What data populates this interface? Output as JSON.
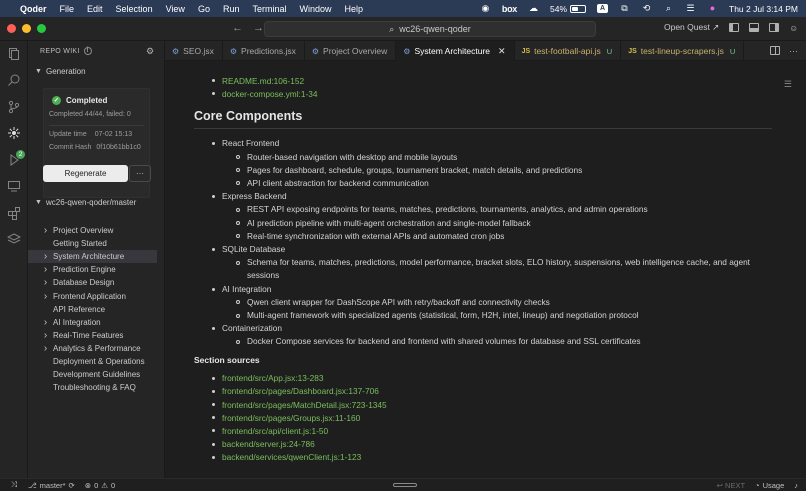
{
  "menubar": {
    "app_name": "Qoder",
    "menus": [
      "File",
      "Edit",
      "Selection",
      "View",
      "Go",
      "Run",
      "Terminal",
      "Window",
      "Help"
    ],
    "box_label": "box",
    "battery_percent": "54%",
    "battery_level": 0.54,
    "input_source": "A",
    "datetime": "Thu 2 Jul  3:14 PM"
  },
  "titlebar": {
    "search_text": "wc26-qwen-qoder",
    "quest_label": "Open Quest ↗"
  },
  "sidepanel": {
    "header": "REPO WIKI",
    "generation_title": "Generation",
    "status": "Completed",
    "completed_text": "Completed 44/44, failed: 0",
    "update_label": "Update time",
    "update_value": "07-02 15:13",
    "commit_label": "Commit Hash",
    "commit_value": "0f10b61bb1c0",
    "regenerate_label": "Regenerate",
    "more_label": "···",
    "repo_title": "wc26-qwen-qoder/master",
    "tree": [
      {
        "label": "Project Overview",
        "chevron": true,
        "selected": false
      },
      {
        "label": "Getting Started",
        "chevron": false,
        "selected": false
      },
      {
        "label": "System Architecture",
        "chevron": true,
        "selected": true
      },
      {
        "label": "Prediction Engine",
        "chevron": true,
        "selected": false
      },
      {
        "label": "Database Design",
        "chevron": true,
        "selected": false
      },
      {
        "label": "Frontend Application",
        "chevron": true,
        "selected": false
      },
      {
        "label": "API Reference",
        "chevron": false,
        "selected": false
      },
      {
        "label": "AI Integration",
        "chevron": true,
        "selected": false
      },
      {
        "label": "Real-Time Features",
        "chevron": true,
        "selected": false
      },
      {
        "label": "Analytics & Performance",
        "chevron": true,
        "selected": false
      },
      {
        "label": "Deployment & Operations",
        "chevron": false,
        "selected": false
      },
      {
        "label": "Development Guidelines",
        "chevron": false,
        "selected": false
      },
      {
        "label": "Troubleshooting & FAQ",
        "chevron": false,
        "selected": false
      }
    ]
  },
  "tabs": [
    {
      "label": "SEO.jsx",
      "icon": "⚙",
      "kind": "react",
      "active": false,
      "untracked": ""
    },
    {
      "label": "Predictions.jsx",
      "icon": "⚙",
      "kind": "react",
      "active": false,
      "untracked": ""
    },
    {
      "label": "Project Overview",
      "icon": "⚙",
      "kind": "wiki",
      "active": false,
      "untracked": ""
    },
    {
      "label": "System Architecture",
      "icon": "⚙",
      "kind": "wiki",
      "active": true,
      "untracked": ""
    },
    {
      "label": "test-football-api.js",
      "icon": "JS",
      "kind": "js",
      "active": false,
      "untracked": "U"
    },
    {
      "label": "test-lineup-scrapers.js",
      "icon": "JS",
      "kind": "js",
      "active": false,
      "untracked": "U"
    }
  ],
  "editor": {
    "top_links": [
      "README.md:106-152",
      "docker-compose.yml:1-34"
    ],
    "heading": "Core Components",
    "components": [
      {
        "title": "React Frontend",
        "items": [
          "Router-based navigation with desktop and mobile layouts",
          "Pages for dashboard, schedule, groups, tournament bracket, match details, and predictions",
          "API client abstraction for backend communication"
        ]
      },
      {
        "title": "Express Backend",
        "items": [
          "REST API exposing endpoints for teams, matches, predictions, tournaments, analytics, and admin operations",
          "AI prediction pipeline with multi-agent orchestration and single-model fallback",
          "Real-time synchronization with external APIs and automated cron jobs"
        ]
      },
      {
        "title": "SQLite Database",
        "items": [
          "Schema for teams, matches, predictions, model performance, bracket slots, ELO history, suspensions, web intelligence cache, and agent sessions"
        ]
      },
      {
        "title": "AI Integration",
        "items": [
          "Qwen client wrapper for DashScope API with retry/backoff and connectivity checks",
          "Multi-agent framework with specialized agents (statistical, form, H2H, intel, lineup) and negotiation protocol"
        ]
      },
      {
        "title": "Containerization",
        "items": [
          "Docker Compose services for backend and frontend with shared volumes for database and SSL certificates"
        ]
      }
    ],
    "sources_heading": "Section sources",
    "sources": [
      "frontend/src/App.jsx:13-283",
      "frontend/src/pages/Dashboard.jsx:137-706",
      "frontend/src/pages/MatchDetail.jsx:723-1345",
      "frontend/src/pages/Groups.jsx:11-160",
      "frontend/src/api/client.js:1-50",
      "backend/server.js:24-786",
      "backend/services/qwenClient.js:1-123"
    ]
  },
  "statusbar": {
    "branch": "master*",
    "errors": "0",
    "warnings": "0",
    "next_label": "↩ NEXT",
    "usage_label": "Usage"
  }
}
